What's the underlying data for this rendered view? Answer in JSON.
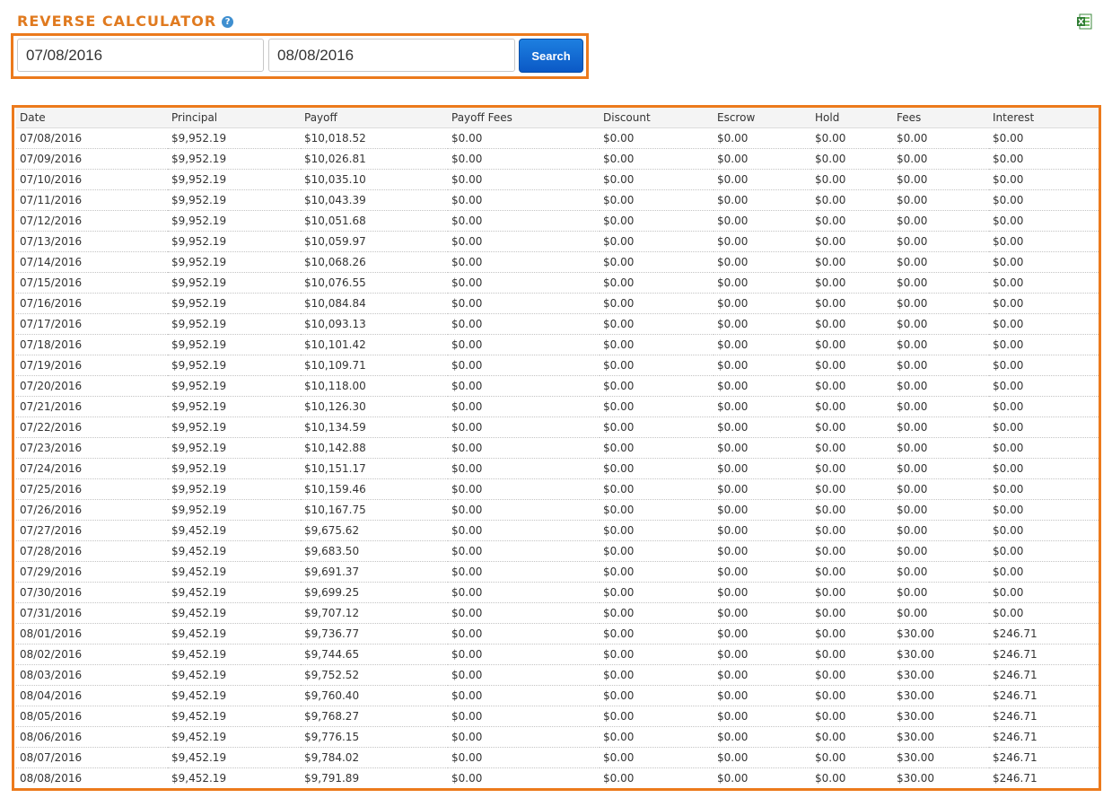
{
  "header": {
    "title": "REVERSE CALCULATOR",
    "help_glyph": "?",
    "help_icon": "question-circle-icon",
    "export_icon": "excel-export-icon"
  },
  "search": {
    "from_value": "07/08/2016",
    "to_value": "08/08/2016",
    "button_label": "Search"
  },
  "colors": {
    "accent": "#ec7a1c",
    "title": "#e07a1f",
    "button": "#0b59c6"
  },
  "table": {
    "columns": [
      "Date",
      "Principal",
      "Payoff",
      "Payoff Fees",
      "Discount",
      "Escrow",
      "Hold",
      "Fees",
      "Interest"
    ],
    "rows": [
      [
        "07/08/2016",
        "$9,952.19",
        "$10,018.52",
        "$0.00",
        "$0.00",
        "$0.00",
        "$0.00",
        "$0.00",
        "$0.00"
      ],
      [
        "07/09/2016",
        "$9,952.19",
        "$10,026.81",
        "$0.00",
        "$0.00",
        "$0.00",
        "$0.00",
        "$0.00",
        "$0.00"
      ],
      [
        "07/10/2016",
        "$9,952.19",
        "$10,035.10",
        "$0.00",
        "$0.00",
        "$0.00",
        "$0.00",
        "$0.00",
        "$0.00"
      ],
      [
        "07/11/2016",
        "$9,952.19",
        "$10,043.39",
        "$0.00",
        "$0.00",
        "$0.00",
        "$0.00",
        "$0.00",
        "$0.00"
      ],
      [
        "07/12/2016",
        "$9,952.19",
        "$10,051.68",
        "$0.00",
        "$0.00",
        "$0.00",
        "$0.00",
        "$0.00",
        "$0.00"
      ],
      [
        "07/13/2016",
        "$9,952.19",
        "$10,059.97",
        "$0.00",
        "$0.00",
        "$0.00",
        "$0.00",
        "$0.00",
        "$0.00"
      ],
      [
        "07/14/2016",
        "$9,952.19",
        "$10,068.26",
        "$0.00",
        "$0.00",
        "$0.00",
        "$0.00",
        "$0.00",
        "$0.00"
      ],
      [
        "07/15/2016",
        "$9,952.19",
        "$10,076.55",
        "$0.00",
        "$0.00",
        "$0.00",
        "$0.00",
        "$0.00",
        "$0.00"
      ],
      [
        "07/16/2016",
        "$9,952.19",
        "$10,084.84",
        "$0.00",
        "$0.00",
        "$0.00",
        "$0.00",
        "$0.00",
        "$0.00"
      ],
      [
        "07/17/2016",
        "$9,952.19",
        "$10,093.13",
        "$0.00",
        "$0.00",
        "$0.00",
        "$0.00",
        "$0.00",
        "$0.00"
      ],
      [
        "07/18/2016",
        "$9,952.19",
        "$10,101.42",
        "$0.00",
        "$0.00",
        "$0.00",
        "$0.00",
        "$0.00",
        "$0.00"
      ],
      [
        "07/19/2016",
        "$9,952.19",
        "$10,109.71",
        "$0.00",
        "$0.00",
        "$0.00",
        "$0.00",
        "$0.00",
        "$0.00"
      ],
      [
        "07/20/2016",
        "$9,952.19",
        "$10,118.00",
        "$0.00",
        "$0.00",
        "$0.00",
        "$0.00",
        "$0.00",
        "$0.00"
      ],
      [
        "07/21/2016",
        "$9,952.19",
        "$10,126.30",
        "$0.00",
        "$0.00",
        "$0.00",
        "$0.00",
        "$0.00",
        "$0.00"
      ],
      [
        "07/22/2016",
        "$9,952.19",
        "$10,134.59",
        "$0.00",
        "$0.00",
        "$0.00",
        "$0.00",
        "$0.00",
        "$0.00"
      ],
      [
        "07/23/2016",
        "$9,952.19",
        "$10,142.88",
        "$0.00",
        "$0.00",
        "$0.00",
        "$0.00",
        "$0.00",
        "$0.00"
      ],
      [
        "07/24/2016",
        "$9,952.19",
        "$10,151.17",
        "$0.00",
        "$0.00",
        "$0.00",
        "$0.00",
        "$0.00",
        "$0.00"
      ],
      [
        "07/25/2016",
        "$9,952.19",
        "$10,159.46",
        "$0.00",
        "$0.00",
        "$0.00",
        "$0.00",
        "$0.00",
        "$0.00"
      ],
      [
        "07/26/2016",
        "$9,952.19",
        "$10,167.75",
        "$0.00",
        "$0.00",
        "$0.00",
        "$0.00",
        "$0.00",
        "$0.00"
      ],
      [
        "07/27/2016",
        "$9,452.19",
        "$9,675.62",
        "$0.00",
        "$0.00",
        "$0.00",
        "$0.00",
        "$0.00",
        "$0.00"
      ],
      [
        "07/28/2016",
        "$9,452.19",
        "$9,683.50",
        "$0.00",
        "$0.00",
        "$0.00",
        "$0.00",
        "$0.00",
        "$0.00"
      ],
      [
        "07/29/2016",
        "$9,452.19",
        "$9,691.37",
        "$0.00",
        "$0.00",
        "$0.00",
        "$0.00",
        "$0.00",
        "$0.00"
      ],
      [
        "07/30/2016",
        "$9,452.19",
        "$9,699.25",
        "$0.00",
        "$0.00",
        "$0.00",
        "$0.00",
        "$0.00",
        "$0.00"
      ],
      [
        "07/31/2016",
        "$9,452.19",
        "$9,707.12",
        "$0.00",
        "$0.00",
        "$0.00",
        "$0.00",
        "$0.00",
        "$0.00"
      ],
      [
        "08/01/2016",
        "$9,452.19",
        "$9,736.77",
        "$0.00",
        "$0.00",
        "$0.00",
        "$0.00",
        "$30.00",
        "$246.71"
      ],
      [
        "08/02/2016",
        "$9,452.19",
        "$9,744.65",
        "$0.00",
        "$0.00",
        "$0.00",
        "$0.00",
        "$30.00",
        "$246.71"
      ],
      [
        "08/03/2016",
        "$9,452.19",
        "$9,752.52",
        "$0.00",
        "$0.00",
        "$0.00",
        "$0.00",
        "$30.00",
        "$246.71"
      ],
      [
        "08/04/2016",
        "$9,452.19",
        "$9,760.40",
        "$0.00",
        "$0.00",
        "$0.00",
        "$0.00",
        "$30.00",
        "$246.71"
      ],
      [
        "08/05/2016",
        "$9,452.19",
        "$9,768.27",
        "$0.00",
        "$0.00",
        "$0.00",
        "$0.00",
        "$30.00",
        "$246.71"
      ],
      [
        "08/06/2016",
        "$9,452.19",
        "$9,776.15",
        "$0.00",
        "$0.00",
        "$0.00",
        "$0.00",
        "$30.00",
        "$246.71"
      ],
      [
        "08/07/2016",
        "$9,452.19",
        "$9,784.02",
        "$0.00",
        "$0.00",
        "$0.00",
        "$0.00",
        "$30.00",
        "$246.71"
      ],
      [
        "08/08/2016",
        "$9,452.19",
        "$9,791.89",
        "$0.00",
        "$0.00",
        "$0.00",
        "$0.00",
        "$30.00",
        "$246.71"
      ]
    ]
  }
}
